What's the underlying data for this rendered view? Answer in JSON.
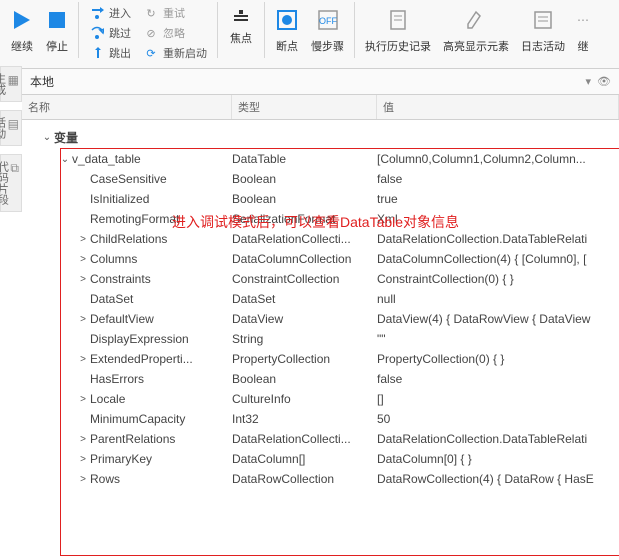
{
  "toolbar": {
    "continue": "继续",
    "stop": "停止",
    "step_in": "进入",
    "step_over": "跳过",
    "step_out": "跳出",
    "retry": "重试",
    "ignore": "忽略",
    "restart": "重新启动",
    "focus": "焦点",
    "breakpoint": "断点",
    "slowstep": "慢步骤",
    "history": "执行历史记录",
    "highlight": "高亮显示元素",
    "log": "日志活动",
    "cont2": "继"
  },
  "side": {
    "build": "生成",
    "activity": "活动",
    "snippets": "代码片段"
  },
  "pane": {
    "title": "本地",
    "expand": "▾",
    "pin": "👁"
  },
  "headers": {
    "name": "名称",
    "type": "类型",
    "value": "值"
  },
  "annotation": "进入调试模式后，可以查看DataTable对象信息",
  "group": {
    "label": "变量",
    "expander": "⌄"
  },
  "root": {
    "name": "v_data_table",
    "type": "DataTable",
    "value": "[Column0,Column1,Column2,Column..."
  },
  "rows": [
    {
      "exp": "",
      "name": "CaseSensitive",
      "type": "Boolean",
      "value": "false"
    },
    {
      "exp": "",
      "name": "IsInitialized",
      "type": "Boolean",
      "value": "true"
    },
    {
      "exp": "",
      "name": "RemotingFormat",
      "type": "SerializationFormat",
      "value": "Xml"
    },
    {
      "exp": ">",
      "name": "ChildRelations",
      "type": "DataRelationCollecti...",
      "value": "DataRelationCollection.DataTableRelati"
    },
    {
      "exp": ">",
      "name": "Columns",
      "type": "DataColumnCollection",
      "value": "DataColumnCollection(4) { [Column0], ["
    },
    {
      "exp": ">",
      "name": "Constraints",
      "type": "ConstraintCollection",
      "value": "ConstraintCollection(0) { }"
    },
    {
      "exp": "",
      "name": "DataSet",
      "type": "DataSet",
      "value": "null"
    },
    {
      "exp": ">",
      "name": "DefaultView",
      "type": "DataView",
      "value": "DataView(4) { DataRowView { DataView"
    },
    {
      "exp": "",
      "name": "DisplayExpression",
      "type": "String",
      "value": "\"\""
    },
    {
      "exp": ">",
      "name": "ExtendedProperti...",
      "type": "PropertyCollection",
      "value": "PropertyCollection(0) { }"
    },
    {
      "exp": "",
      "name": "HasErrors",
      "type": "Boolean",
      "value": "false"
    },
    {
      "exp": ">",
      "name": "Locale",
      "type": "CultureInfo",
      "value": "[]"
    },
    {
      "exp": "",
      "name": "MinimumCapacity",
      "type": "Int32",
      "value": "50"
    },
    {
      "exp": ">",
      "name": "ParentRelations",
      "type": "DataRelationCollecti...",
      "value": "DataRelationCollection.DataTableRelati"
    },
    {
      "exp": ">",
      "name": "PrimaryKey",
      "type": "DataColumn[]",
      "value": "DataColumn[0] { }"
    },
    {
      "exp": ">",
      "name": "Rows",
      "type": "DataRowCollection",
      "value": "DataRowCollection(4) { DataRow { HasE"
    }
  ]
}
